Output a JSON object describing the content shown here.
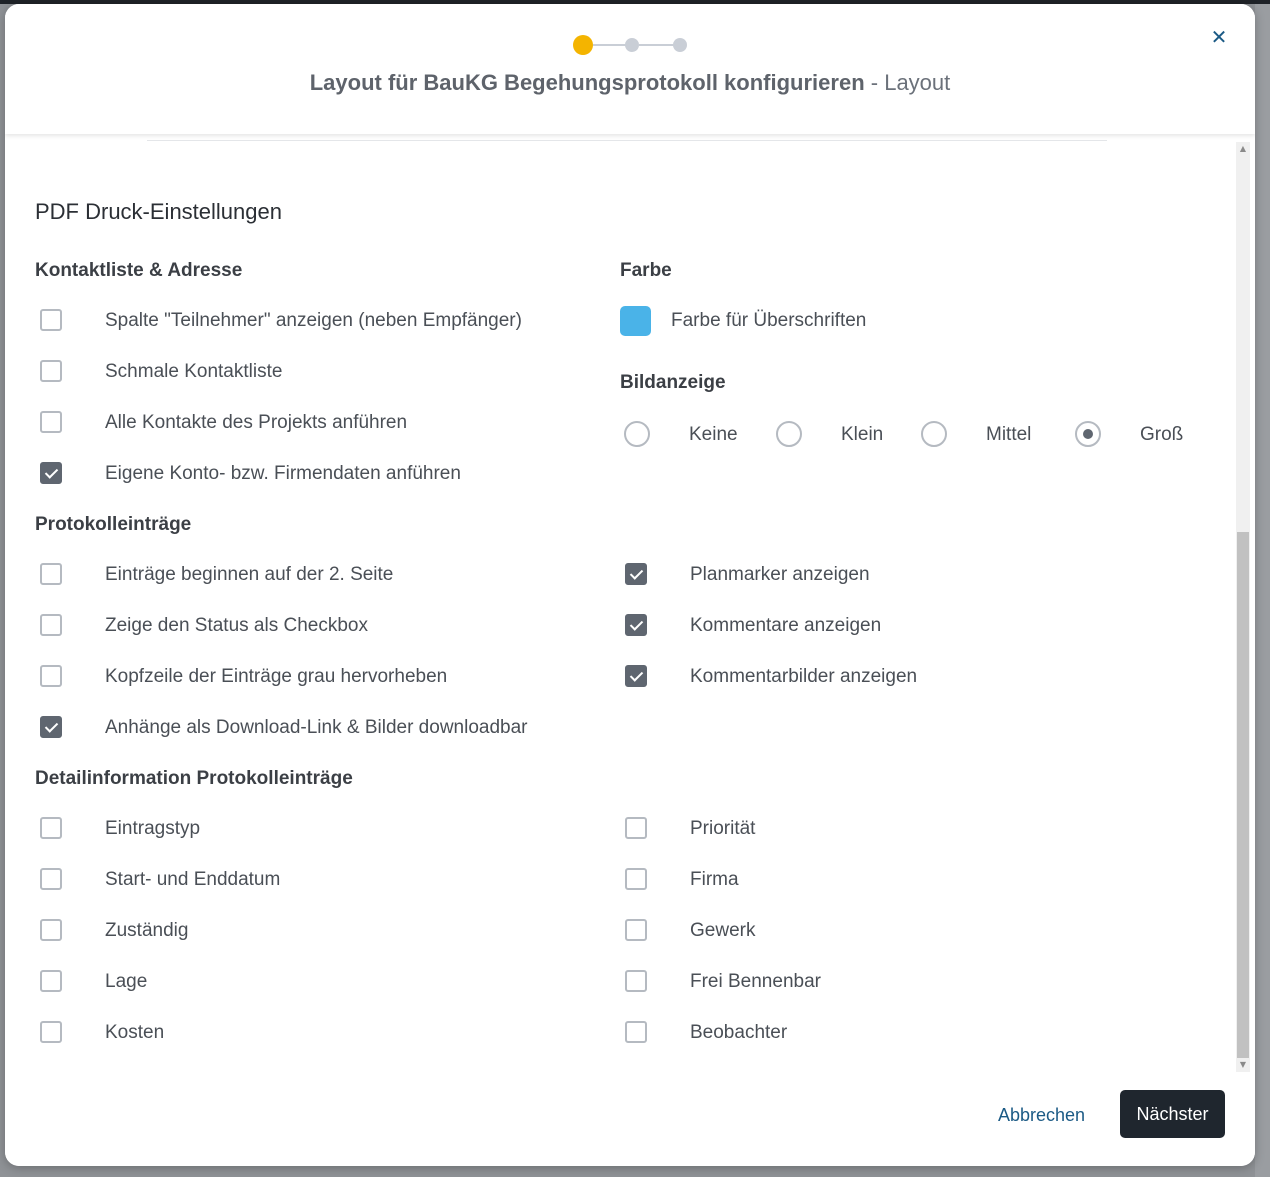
{
  "header": {
    "title_strong": "Layout für BauKG Begehungsprotokoll konfigurieren",
    "title_separator": " - ",
    "title_step": "Layout",
    "close_icon": "close-icon",
    "steps": [
      {
        "state": "active",
        "color": "#f4b400"
      },
      {
        "state": "pending",
        "color": "#c9ced6"
      },
      {
        "state": "pending",
        "color": "#c9ced6"
      }
    ]
  },
  "section_title": "PDF Druck-Einstellungen",
  "contacts": {
    "title": "Kontaktliste & Adresse",
    "items": [
      {
        "label": "Spalte \"Teilnehmer\" anzeigen (neben Empfänger)",
        "checked": false
      },
      {
        "label": "Schmale Kontaktliste",
        "checked": false
      },
      {
        "label": "Alle Kontakte des Projekts anführen",
        "checked": false
      },
      {
        "label": "Eigene Konto- bzw. Firmendaten anführen",
        "checked": true
      }
    ]
  },
  "color": {
    "title": "Farbe",
    "label": "Farbe für Überschriften",
    "value": "#4ab3e8"
  },
  "image_display": {
    "title": "Bildanzeige",
    "options": [
      {
        "label": "Keine",
        "checked": false
      },
      {
        "label": "Klein",
        "checked": false
      },
      {
        "label": "Mittel",
        "checked": false
      },
      {
        "label": "Groß",
        "checked": true
      }
    ]
  },
  "entries": {
    "title": "Protokolleinträge",
    "left": [
      {
        "label": "Einträge beginnen auf der 2. Seite",
        "checked": false
      },
      {
        "label": "Zeige den Status als Checkbox",
        "checked": false
      },
      {
        "label": "Kopfzeile der Einträge grau hervorheben",
        "checked": false
      },
      {
        "label": "Anhänge als Download-Link & Bilder downloadbar",
        "checked": true
      }
    ],
    "right": [
      {
        "label": "Planmarker anzeigen",
        "checked": true
      },
      {
        "label": "Kommentare anzeigen",
        "checked": true
      },
      {
        "label": "Kommentarbilder anzeigen",
        "checked": true
      }
    ]
  },
  "details": {
    "title": "Detailinformation Protokolleinträge",
    "left": [
      {
        "label": "Eintragstyp",
        "checked": false
      },
      {
        "label": "Start- und Enddatum",
        "checked": false
      },
      {
        "label": "Zuständig",
        "checked": false
      },
      {
        "label": "Lage",
        "checked": false
      },
      {
        "label": "Kosten",
        "checked": false
      }
    ],
    "right": [
      {
        "label": "Priorität",
        "checked": false
      },
      {
        "label": "Firma",
        "checked": false
      },
      {
        "label": "Gewerk",
        "checked": false
      },
      {
        "label": "Frei Bennenbar",
        "checked": false
      },
      {
        "label": "Beobachter",
        "checked": false
      }
    ]
  },
  "footer": {
    "cancel_label": "Abbrechen",
    "next_label": "Nächster"
  }
}
